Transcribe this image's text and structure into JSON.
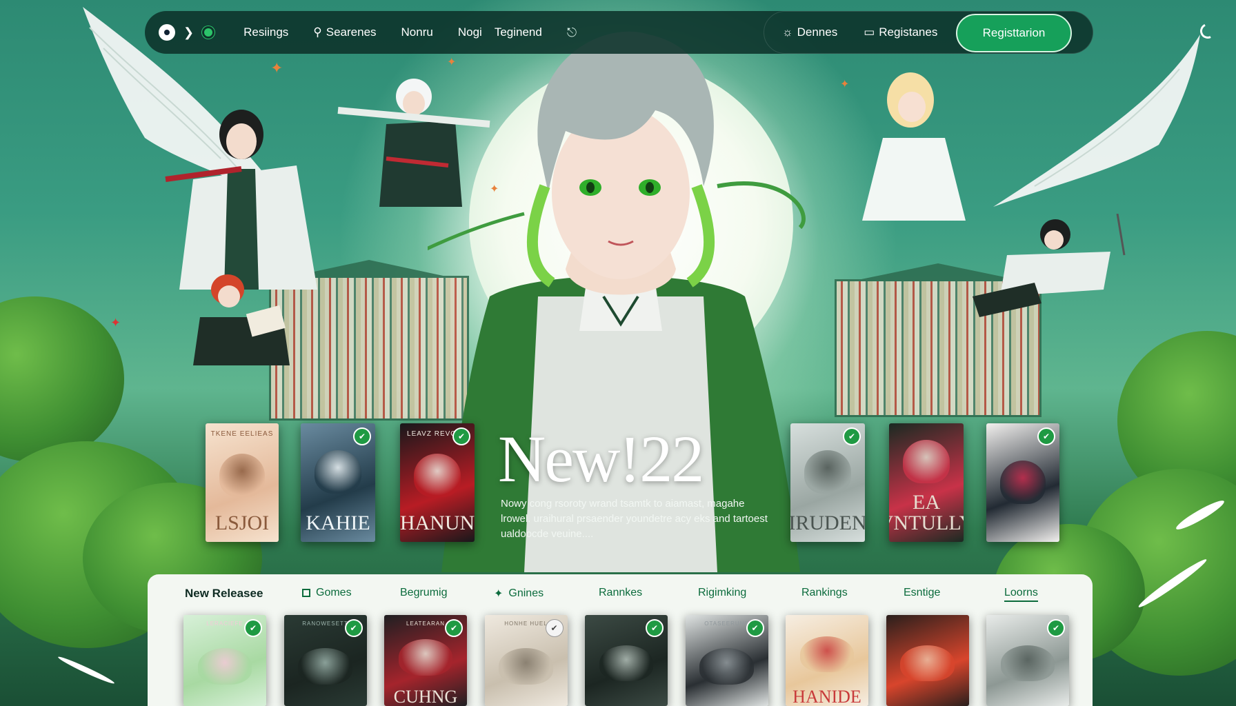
{
  "nav": {
    "links": [
      "Resiings",
      "Searenes",
      "Nonru",
      "Nogi",
      "Teginend"
    ],
    "right_links": [
      "Dennes",
      "Registanes"
    ],
    "register_button": "Registtarion"
  },
  "hero": {
    "title": "New!22",
    "description": "Nowy cong rsoroty wrand tsamtk to aiamast, magahe lrowel. uraihural prsaender youndetre acy eks and tartoest ualdoocde veuine...."
  },
  "hero_covers": [
    {
      "top": "TKENE EELIEAS",
      "title": "LSJOI",
      "palette": [
        "#f6e3cf",
        "#e4b99a",
        "#8a5a3c"
      ],
      "badge": ""
    },
    {
      "top": "",
      "title": "KAHIE",
      "palette": [
        "#6a8ba0",
        "#233c4a",
        "#f0f6f8"
      ],
      "badge": "check"
    },
    {
      "top": "LEAVZ REVOSN",
      "title": "LHANUNZ",
      "palette": [
        "#18181b",
        "#b81c24",
        "#f0e9e0"
      ],
      "badge": "check"
    },
    {
      "top": "",
      "title": "HIRUDENN",
      "palette": [
        "#d7dfdd",
        "#9aa6a2",
        "#4a5450"
      ],
      "badge": "check"
    },
    {
      "top": "",
      "title": "EA VNTULLY",
      "palette": [
        "#1a2a22",
        "#c83248",
        "#e6ddd0"
      ],
      "badge": ""
    },
    {
      "top": "",
      "title": "",
      "palette": [
        "#f2f0ee",
        "#222a33",
        "#c4284a"
      ],
      "badge": "check"
    }
  ],
  "tabs": [
    {
      "label": "New Releasee",
      "active": true
    },
    {
      "label": "Gomes",
      "icon": "square-icon"
    },
    {
      "label": "Begrumig"
    },
    {
      "label": "Gnines",
      "icon": "star-icon"
    },
    {
      "label": "Rannkes"
    },
    {
      "label": "Rigimking"
    },
    {
      "label": "Rankings"
    },
    {
      "label": "Esntige"
    },
    {
      "label": "Loorns",
      "underlined": true
    }
  ],
  "release_covers": [
    {
      "top": "LERACIEFE",
      "title": "",
      "palette": [
        "#d7f0d8",
        "#a8d9a2",
        "#f4c9d8"
      ],
      "badge": "check"
    },
    {
      "top": "RANOWESETT",
      "title": "",
      "palette": [
        "#2a3a34",
        "#1b2521",
        "#9db5ad"
      ],
      "badge": "check"
    },
    {
      "top": "LEATEARAN",
      "title": "CUHNG",
      "palette": [
        "#1f1f22",
        "#a5242c",
        "#ece3d8"
      ],
      "badge": "check"
    },
    {
      "top": "HONHE HUEL",
      "title": "",
      "palette": [
        "#efe9df",
        "#c9bfae",
        "#7f7566"
      ],
      "badge": "light"
    },
    {
      "top": "",
      "title": "",
      "palette": [
        "#3c4a44",
        "#1c2622",
        "#b6c3bc"
      ],
      "badge": "check"
    },
    {
      "top": "OTASEERUNE",
      "title": "",
      "palette": [
        "#dfe3e2",
        "#2a2f33",
        "#90989c"
      ],
      "badge": "check"
    },
    {
      "top": "",
      "title": "HANIDE",
      "palette": [
        "#f6eee2",
        "#e8c79b",
        "#c83a3a"
      ],
      "badge": ""
    },
    {
      "top": "",
      "title": "",
      "palette": [
        "#2a1f1c",
        "#d8452c",
        "#f0c2a6"
      ],
      "badge": ""
    },
    {
      "top": "",
      "title": "",
      "palette": [
        "#e8ebe9",
        "#8d9894",
        "#4f5a56"
      ],
      "badge": "check"
    }
  ],
  "colors": {
    "accent": "#16a05a",
    "nav_bg": "#0d322a",
    "tab_text": "#0b6b3c",
    "panel_bg": "#f3f7f2"
  }
}
